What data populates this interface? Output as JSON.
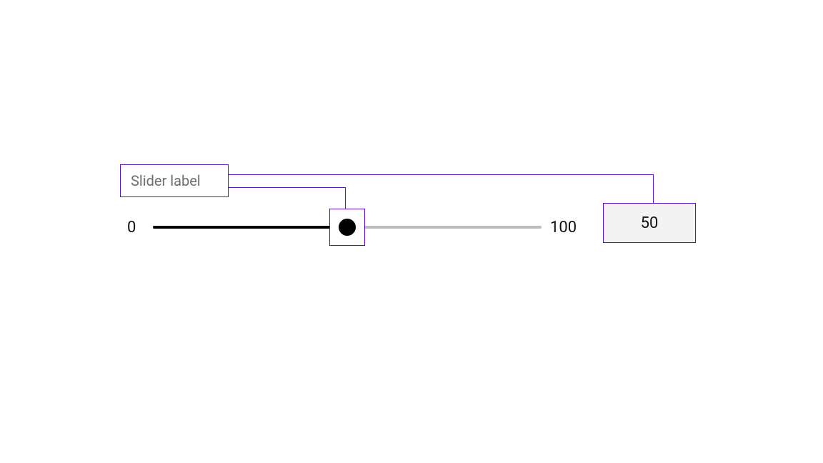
{
  "slider": {
    "label": "Slider label",
    "min": "0",
    "max": "100",
    "value": "50",
    "percent": 50
  },
  "colors": {
    "annotation": "#5a0fb8",
    "track_bg": "#bdbdbd",
    "track_fill": "#000000",
    "handle": "#000000",
    "value_bg": "#f3f3f3"
  }
}
